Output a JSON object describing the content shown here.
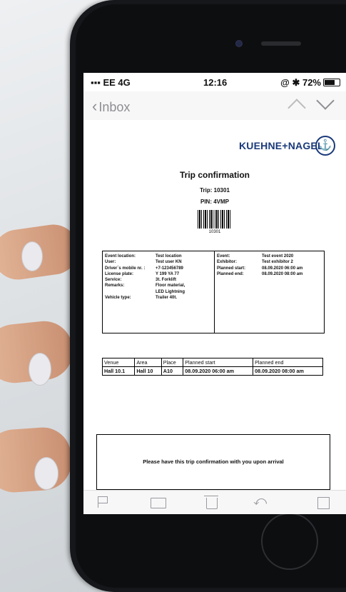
{
  "status_bar": {
    "carrier": "EE 4G",
    "time": "12:16",
    "battery": "72%"
  },
  "nav": {
    "back_label": "Inbox"
  },
  "doc": {
    "brand": "KUEHNE+NAGEL",
    "title": "Trip confirmation",
    "trip": "Trip: 10301",
    "pin": "PIN: 4VMP",
    "barcode_number": "10301",
    "info_left": [
      {
        "label": "Event location:",
        "value": "Test location"
      },
      {
        "label": "User:",
        "value": "Test user KN"
      },
      {
        "label": "Driver`s mobile nr. :",
        "value": "+7-123456789"
      },
      {
        "label": "License plate:",
        "value": "Y 199 YA 77"
      },
      {
        "label": "Service:",
        "value": "3t. Forklift"
      },
      {
        "label": "Remarks:",
        "value": "Floor material,"
      },
      {
        "label": "",
        "value": "LED Lightning"
      },
      {
        "label": "Vehicle type:",
        "value": "Trailer 40t."
      }
    ],
    "info_right": [
      {
        "label": "Event:",
        "value": "Test event 2020"
      },
      {
        "label": "Exhibitor:",
        "value": "Test exhibitor 2"
      },
      {
        "label": "Planned start:",
        "value": "08.09.2020 06:00 am"
      },
      {
        "label": "Planned end:",
        "value": "08.09.2020 08:00 am"
      }
    ],
    "venue_table": {
      "headers": [
        "Venue",
        "Area",
        "Place",
        "Planned start",
        "Planned end"
      ],
      "row": [
        "Hall 10.1",
        "Hall 10",
        "A10",
        "08.09.2020 06:00 am",
        "08.09.2020 08:00 am"
      ]
    },
    "footer_note": "Please have this trip confirmation with you upon arrival"
  }
}
